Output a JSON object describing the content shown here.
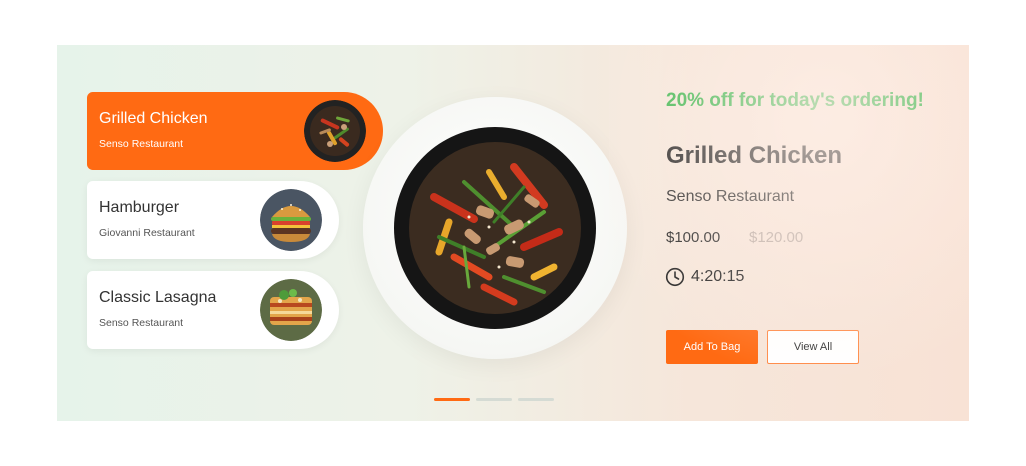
{
  "menu": {
    "items": [
      {
        "name": "Grilled Chicken",
        "restaurant": "Senso Restaurant",
        "active": true,
        "image": "stir-fry-dish"
      },
      {
        "name": "Hamburger",
        "restaurant": "Giovanni Restaurant",
        "active": false,
        "image": "hamburger"
      },
      {
        "name": "Classic Lasagna",
        "restaurant": "Senso Restaurant",
        "active": false,
        "image": "lasagna"
      }
    ]
  },
  "featured": {
    "offer": "20% off for today's ordering!",
    "title": "Grilled Chicken",
    "restaurant": "Senso Restaurant",
    "price": "$100.00",
    "old_price": "$120.00",
    "timer": "4:20:15",
    "timer_icon": "clock-icon",
    "add_to_bag_label": "Add To Bag",
    "view_all_label": "View All"
  },
  "pagination": {
    "total": 3,
    "active_index": 0
  },
  "colors": {
    "accent": "#ff6a13",
    "offer": "#2fb344",
    "old_price": "#b9aaa2"
  }
}
